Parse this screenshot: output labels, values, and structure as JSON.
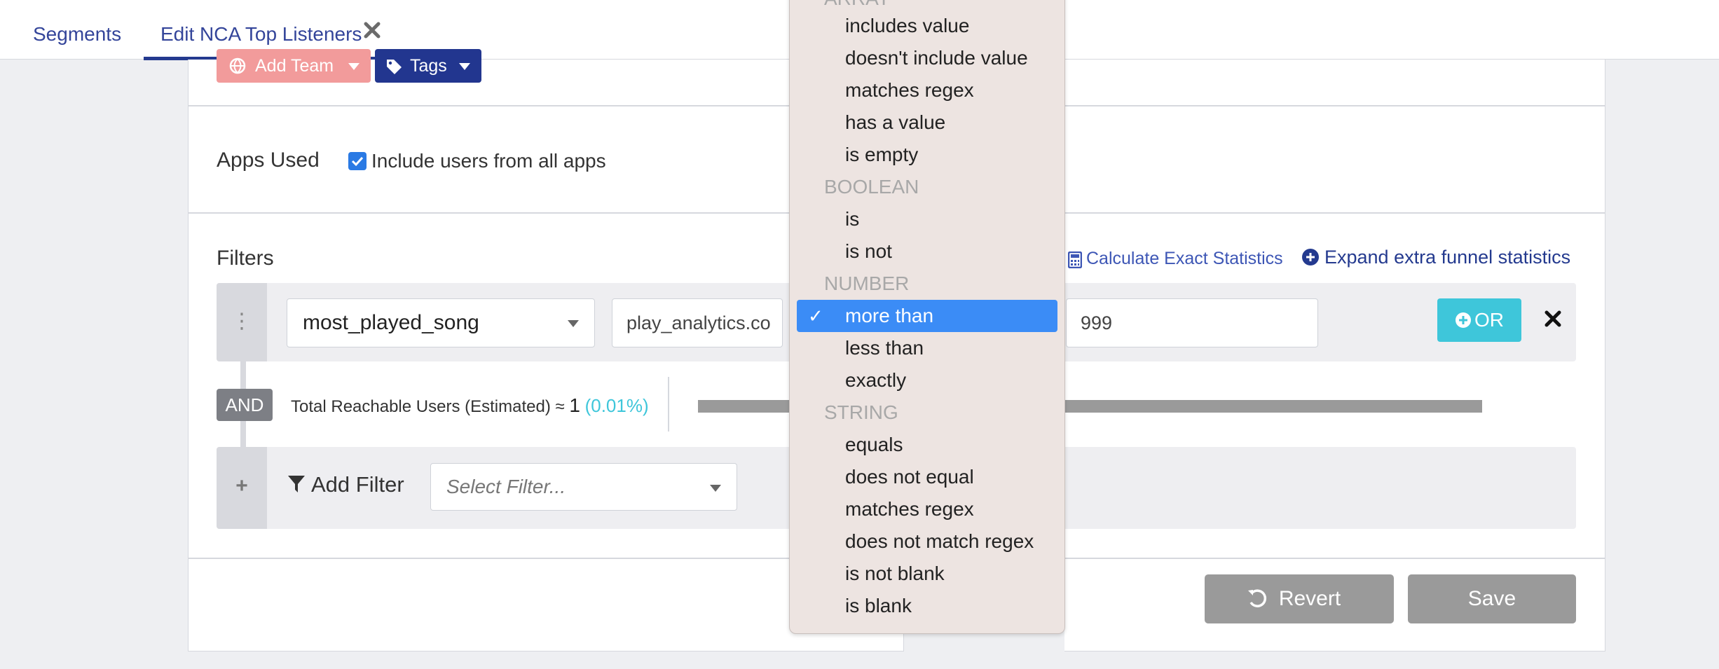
{
  "tabs": {
    "segments": "Segments",
    "edit": "Edit NCA Top Listeners"
  },
  "header_buttons": {
    "team": "Add Team",
    "tags": "Tags"
  },
  "apps_used": {
    "label": "Apps Used",
    "checkbox_label": "Include users from all apps",
    "checked": true
  },
  "filters": {
    "label": "Filters",
    "calc_link": "Calculate Exact Statistics",
    "expand_link": "Expand extra funnel statistics",
    "row": {
      "property": "most_played_song",
      "source": "play_analytics.co",
      "operator": "more than",
      "value": "999",
      "or_label": "OR"
    },
    "and_label": "AND",
    "reach": {
      "label": "Total Reachable Users (Estimated) ≈",
      "count": "1",
      "percent": "(0.01%)"
    },
    "add_filter_label": "Add Filter",
    "select_placeholder": "Select Filter..."
  },
  "actions": {
    "revert": "Revert",
    "save": "Save"
  },
  "dropdown": {
    "groups": [
      {
        "heading": "ARRAY",
        "options": [
          "includes value",
          "doesn't include value",
          "matches regex",
          "has a value",
          "is empty"
        ]
      },
      {
        "heading": "BOOLEAN",
        "options": [
          "is",
          "is not"
        ]
      },
      {
        "heading": "NUMBER",
        "options": [
          "more than",
          "less than",
          "exactly"
        ]
      },
      {
        "heading": "STRING",
        "options": [
          "equals",
          "does not equal",
          "matches regex",
          "does not match regex",
          "is not blank",
          "is blank"
        ]
      }
    ],
    "selected": "more than"
  },
  "colors": {
    "brand_navy": "#22368f",
    "team_pink": "#f29b9b",
    "or_teal": "#3ec6da",
    "selected_blue": "#3b8cf6"
  }
}
